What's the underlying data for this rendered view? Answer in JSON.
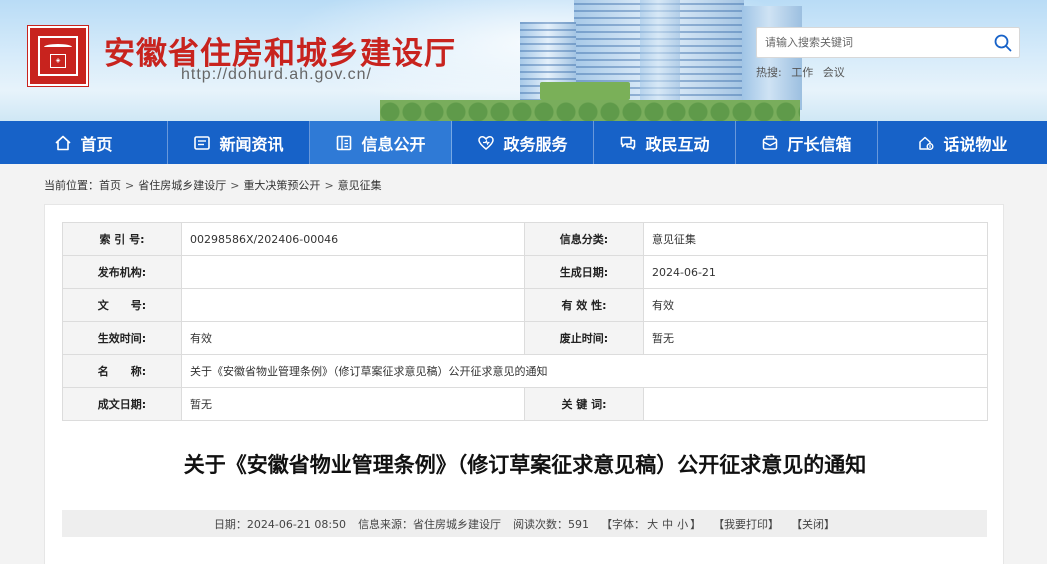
{
  "header": {
    "site_title": "安徽省住房和城乡建设厅",
    "site_url": "http://dohurd.ah.gov.cn/",
    "search_placeholder": "请输入搜索关键词",
    "hot_label": "热搜:",
    "hot_keywords": [
      "工作",
      "会议"
    ]
  },
  "nav": {
    "items": [
      {
        "label": "首页",
        "icon": "home-icon"
      },
      {
        "label": "新闻资讯",
        "icon": "news-icon"
      },
      {
        "label": "信息公开",
        "icon": "document-icon"
      },
      {
        "label": "政务服务",
        "icon": "service-icon"
      },
      {
        "label": "政民互动",
        "icon": "chat-icon"
      },
      {
        "label": "厅长信箱",
        "icon": "mailbox-icon"
      },
      {
        "label": "话说物业",
        "icon": "property-icon"
      }
    ],
    "active_index": 2
  },
  "breadcrumb": {
    "prefix": "当前位置：",
    "items": [
      "首页",
      "省住房城乡建设厅",
      "重大决策预公开",
      "意见征集"
    ],
    "separator": ">"
  },
  "meta": {
    "index_label": "索 引 号:",
    "index_value": "00298586X/202406-00046",
    "category_label": "信息分类:",
    "category_value": "意见征集",
    "publisher_label": "发布机构:",
    "publisher_value": "",
    "created_label": "生成日期:",
    "created_value": "2024-06-21",
    "docno_label": "文　　号:",
    "docno_value": "",
    "validity_label": "有 效 性:",
    "validity_value": "有效",
    "effective_label": "生效时间:",
    "effective_value": "有效",
    "repeal_label": "废止时间:",
    "repeal_value": "暂无",
    "name_label": "名　　称:",
    "name_value": "关于《安徽省物业管理条例》（修订草案征求意见稿）公开征求意见的通知",
    "written_label": "成文日期:",
    "written_value": "暂无",
    "keywords_label": "关 键 词:",
    "keywords_value": ""
  },
  "article": {
    "title": "关于《安徽省物业管理条例》（修订草案征求意见稿）公开征求意见的通知",
    "date_text": "日期：2024-06-21 08:50",
    "source_text": "信息来源：省住房城乡建设厅",
    "views_text": "阅读次数：591",
    "font_prefix": "【字体：",
    "font_large": "大",
    "font_medium": "中",
    "font_small": "小",
    "font_suffix": "】",
    "print_text": "【我要打印】",
    "close_text": "【关闭】"
  },
  "colors": {
    "brand_red": "#c8231e",
    "nav_blue": "#1762c8",
    "nav_active": "#2f7ad6"
  }
}
